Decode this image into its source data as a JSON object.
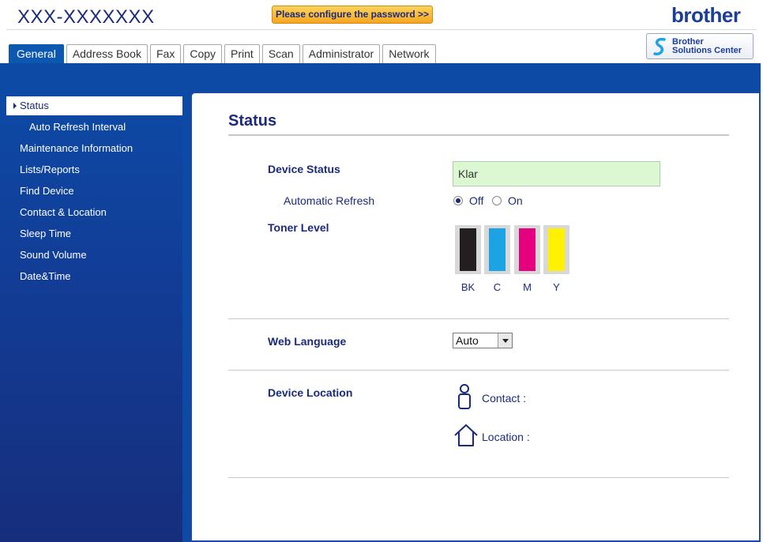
{
  "header": {
    "model": "XXX-XXXXXXX",
    "password_banner": "Please configure the password >>",
    "brand": "brother",
    "solutions": {
      "line1": "Brother",
      "line2": "Solutions Center"
    }
  },
  "tabs": [
    {
      "label": "General",
      "active": true
    },
    {
      "label": "Address Book"
    },
    {
      "label": "Fax"
    },
    {
      "label": "Copy"
    },
    {
      "label": "Print"
    },
    {
      "label": "Scan"
    },
    {
      "label": "Administrator"
    },
    {
      "label": "Network"
    }
  ],
  "sidebar": {
    "items": [
      {
        "label": "Status",
        "active": true
      },
      {
        "label": "Auto Refresh Interval",
        "sub": true
      },
      {
        "label": "Maintenance Information"
      },
      {
        "label": "Lists/Reports"
      },
      {
        "label": "Find Device"
      },
      {
        "label": "Contact & Location"
      },
      {
        "label": "Sleep Time"
      },
      {
        "label": "Sound Volume"
      },
      {
        "label": "Date&Time"
      }
    ]
  },
  "main": {
    "title": "Status",
    "device_status": {
      "label": "Device Status",
      "value": "Klar"
    },
    "auto_refresh": {
      "label": "Automatic Refresh",
      "off": "Off",
      "on": "On",
      "selected": "Off"
    },
    "toner": {
      "label": "Toner Level",
      "cartridges": [
        {
          "label": "BK",
          "color": "#231f20"
        },
        {
          "label": "C",
          "color": "#1ba3e3"
        },
        {
          "label": "M",
          "color": "#e4007f"
        },
        {
          "label": "Y",
          "color": "#fff100"
        }
      ]
    },
    "web_language": {
      "label": "Web Language",
      "value": "Auto"
    },
    "device_location": {
      "label": "Device Location",
      "contact": "Contact :",
      "location": "Location :"
    }
  }
}
